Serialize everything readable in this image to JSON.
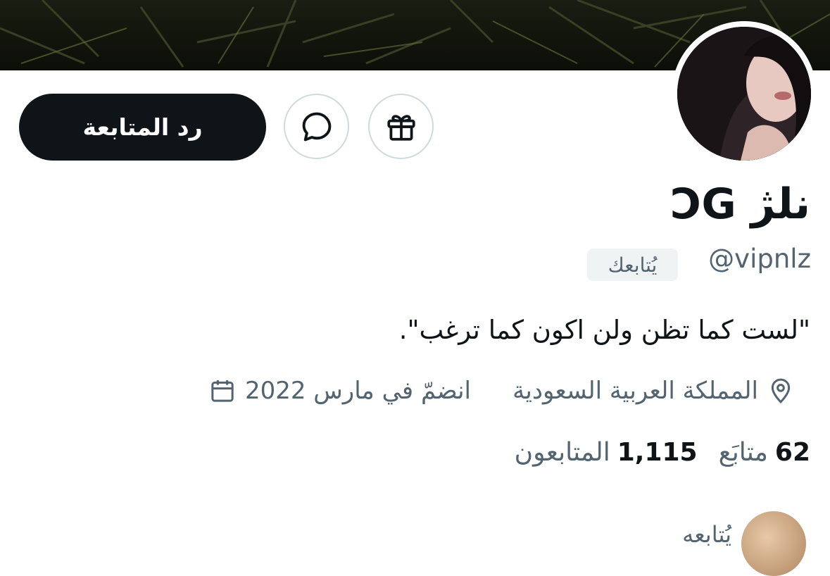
{
  "profile": {
    "display_name": "نلژ ƆG",
    "handle": "@vipnlz",
    "follows_you_badge": "يُتابعك",
    "bio": "\"لست كما تظن ولن اكون كما ترغب\".",
    "location": "المملكة العربية السعودية",
    "joined": "انضمّ في مارس 2022"
  },
  "actions": {
    "follow_back_label": "رد المتابعة"
  },
  "stats": {
    "following_count": "62",
    "following_label": "متابَع",
    "followers_count": "1,115",
    "followers_label": "المتابعون"
  },
  "followed_by": {
    "text": "يُتابعه"
  },
  "icons": {
    "message": "message-icon",
    "gift": "gift-icon",
    "location": "location-pin-icon",
    "calendar": "calendar-icon"
  },
  "colors": {
    "primary_text": "#0f1419",
    "secondary_text": "#536471",
    "button_bg": "#0f1419",
    "badge_bg": "#eff3f4",
    "border": "#cfd9de"
  }
}
